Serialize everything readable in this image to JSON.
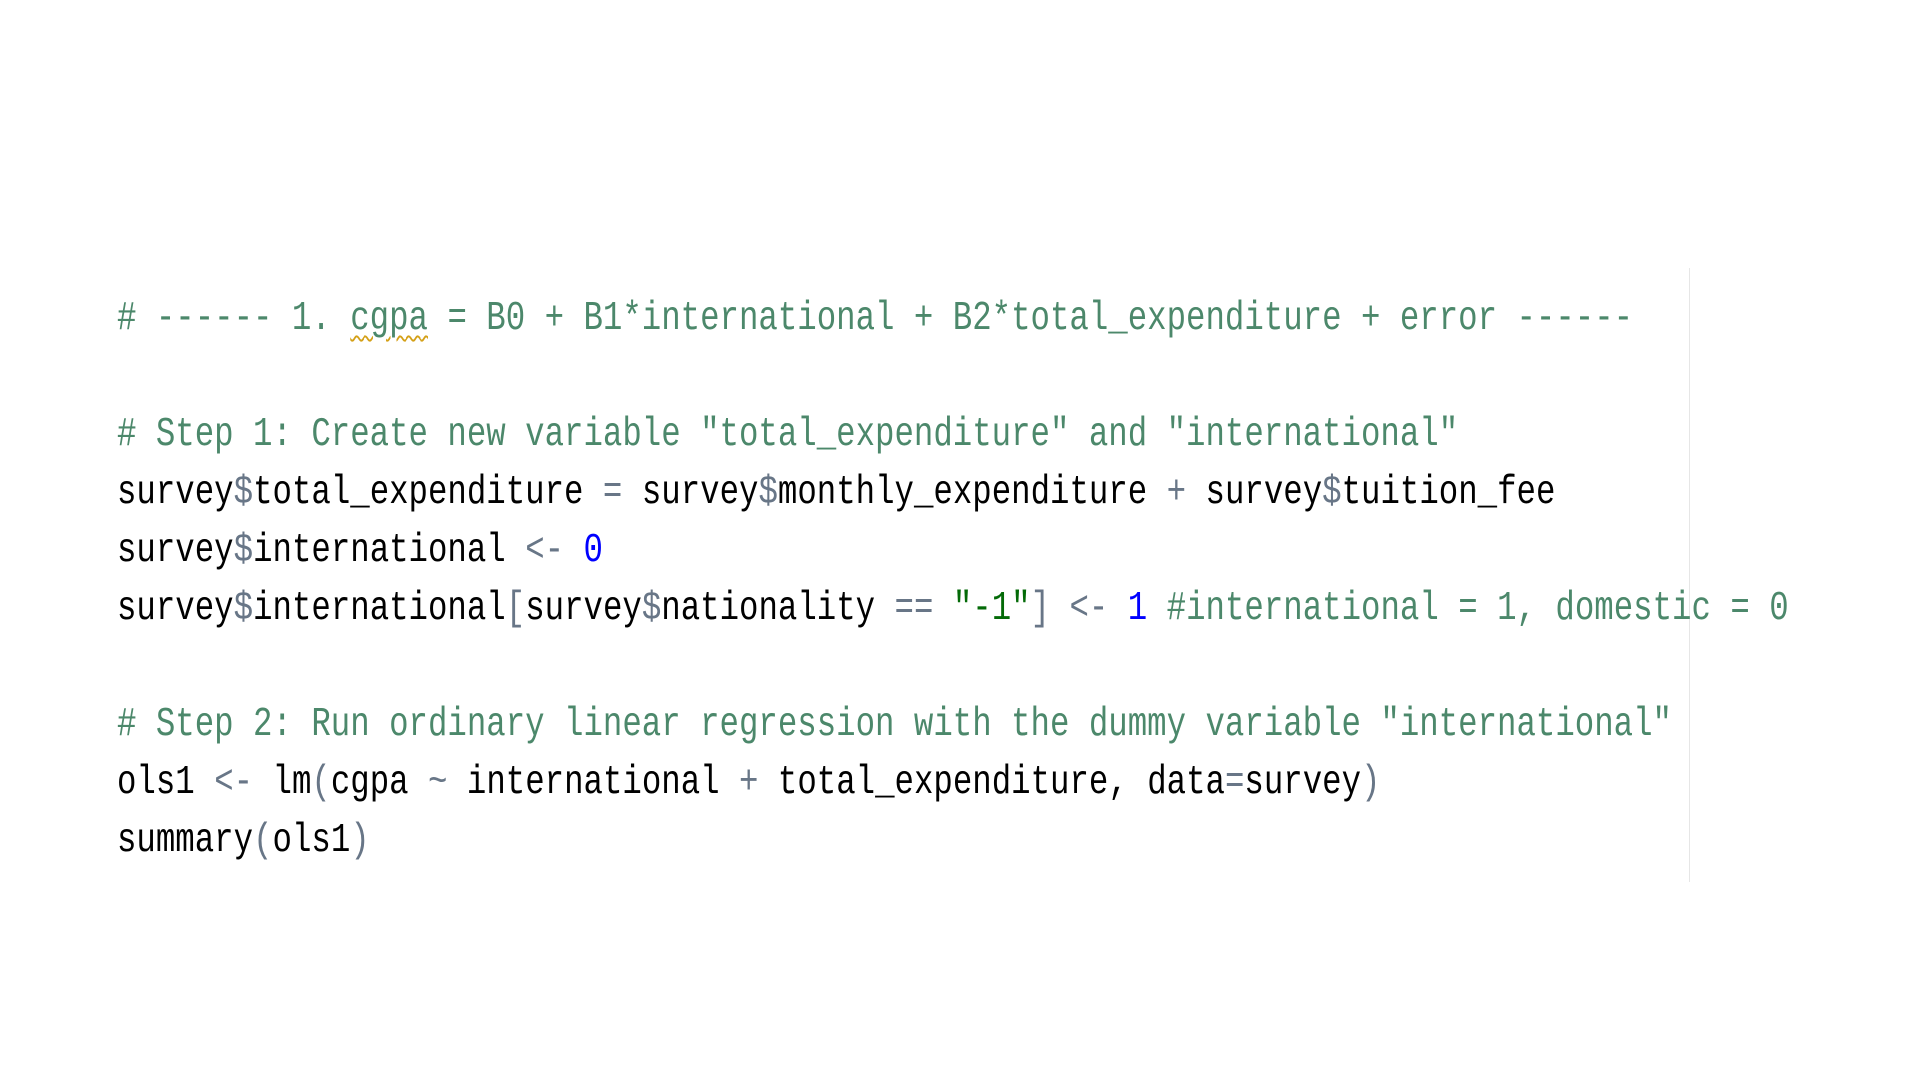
{
  "editor": {
    "lines": [
      {
        "tokens": [
          {
            "kind": "cmt",
            "text": "# ------ 1. "
          },
          {
            "kind": "cmt-spell",
            "text": "cgpa"
          },
          {
            "kind": "cmt",
            "text": " = B0 + B1*international + B2*total_expenditure + error ------"
          }
        ]
      },
      {
        "tokens": []
      },
      {
        "tokens": [
          {
            "kind": "cmt",
            "text": "# Step 1: Create new variable \"total_expenditure\" and \"international\""
          }
        ]
      },
      {
        "tokens": [
          {
            "kind": "plain",
            "text": "survey"
          },
          {
            "kind": "op",
            "text": "$"
          },
          {
            "kind": "plain",
            "text": "total_expenditure "
          },
          {
            "kind": "op",
            "text": "="
          },
          {
            "kind": "plain",
            "text": " survey"
          },
          {
            "kind": "op",
            "text": "$"
          },
          {
            "kind": "plain",
            "text": "monthly_expenditure "
          },
          {
            "kind": "op",
            "text": "+"
          },
          {
            "kind": "plain",
            "text": " survey"
          },
          {
            "kind": "op",
            "text": "$"
          },
          {
            "kind": "plain",
            "text": "tuition_fee"
          }
        ]
      },
      {
        "tokens": [
          {
            "kind": "plain",
            "text": "survey"
          },
          {
            "kind": "op",
            "text": "$"
          },
          {
            "kind": "plain",
            "text": "international "
          },
          {
            "kind": "op",
            "text": "<-"
          },
          {
            "kind": "plain",
            "text": " "
          },
          {
            "kind": "num",
            "text": "0"
          }
        ]
      },
      {
        "tokens": [
          {
            "kind": "plain",
            "text": "survey"
          },
          {
            "kind": "op",
            "text": "$"
          },
          {
            "kind": "plain",
            "text": "international"
          },
          {
            "kind": "punct",
            "text": "["
          },
          {
            "kind": "plain",
            "text": "survey"
          },
          {
            "kind": "op",
            "text": "$"
          },
          {
            "kind": "plain",
            "text": "nationality "
          },
          {
            "kind": "op",
            "text": "=="
          },
          {
            "kind": "plain",
            "text": " "
          },
          {
            "kind": "str",
            "text": "\"-1\""
          },
          {
            "kind": "punct",
            "text": "]"
          },
          {
            "kind": "plain",
            "text": " "
          },
          {
            "kind": "op",
            "text": "<-"
          },
          {
            "kind": "plain",
            "text": " "
          },
          {
            "kind": "num",
            "text": "1"
          },
          {
            "kind": "plain",
            "text": " "
          },
          {
            "kind": "cmt",
            "text": "#international = 1, domestic = 0"
          }
        ]
      },
      {
        "tokens": []
      },
      {
        "tokens": [
          {
            "kind": "cmt",
            "text": "# Step 2: Run ordinary linear regression with the dummy variable \"international\""
          }
        ]
      },
      {
        "tokens": [
          {
            "kind": "plain",
            "text": "ols1 "
          },
          {
            "kind": "op",
            "text": "<-"
          },
          {
            "kind": "plain",
            "text": " lm"
          },
          {
            "kind": "punct",
            "text": "("
          },
          {
            "kind": "plain",
            "text": "cgpa "
          },
          {
            "kind": "op",
            "text": "~"
          },
          {
            "kind": "plain",
            "text": " international "
          },
          {
            "kind": "op",
            "text": "+"
          },
          {
            "kind": "plain",
            "text": " total_expenditure, data"
          },
          {
            "kind": "op",
            "text": "="
          },
          {
            "kind": "plain",
            "text": "survey"
          },
          {
            "kind": "punct",
            "text": ")"
          }
        ]
      },
      {
        "tokens": [
          {
            "kind": "plain",
            "text": "summary"
          },
          {
            "kind": "punct",
            "text": "("
          },
          {
            "kind": "plain",
            "text": "ols1"
          },
          {
            "kind": "punct",
            "text": ")"
          }
        ]
      }
    ]
  },
  "colors": {
    "comment": "#4c886b",
    "number": "#0000ff",
    "string": "#036a07",
    "operator": "#687687",
    "text": "#000000",
    "background": "#ffffff"
  }
}
